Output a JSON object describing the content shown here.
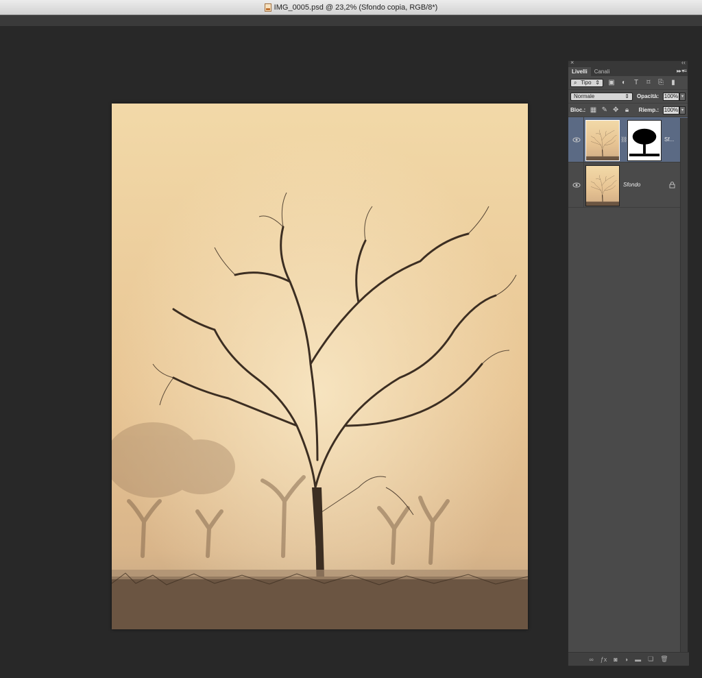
{
  "window": {
    "title": "IMG_0005.psd @ 23,2% (Sfondo copia, RGB/8*)"
  },
  "panel": {
    "tabs": [
      {
        "label": "Livelli",
        "active": true
      },
      {
        "label": "Canali",
        "active": false
      }
    ],
    "filter": {
      "label": "Tipo"
    },
    "blend_mode": "Normale",
    "opacity_label": "Opacità:",
    "opacity_value": "100%",
    "lock_label": "Bloc.:",
    "fill_label": "Riemp.:",
    "fill_value": "100%",
    "layers": [
      {
        "name": "Sf...",
        "selected": true,
        "has_mask": true
      },
      {
        "name": "Sfondo",
        "selected": false,
        "locked": true
      }
    ]
  },
  "colors": {
    "selected_layer": "#5b6a84",
    "panel_bg": "#4a4a4a",
    "app_bg": "#282828"
  },
  "icons": {
    "bottom_bar": [
      "link-icon",
      "fx-icon",
      "mask-icon",
      "adjustment-icon",
      "folder-icon",
      "new-layer-icon",
      "trash-icon"
    ]
  }
}
